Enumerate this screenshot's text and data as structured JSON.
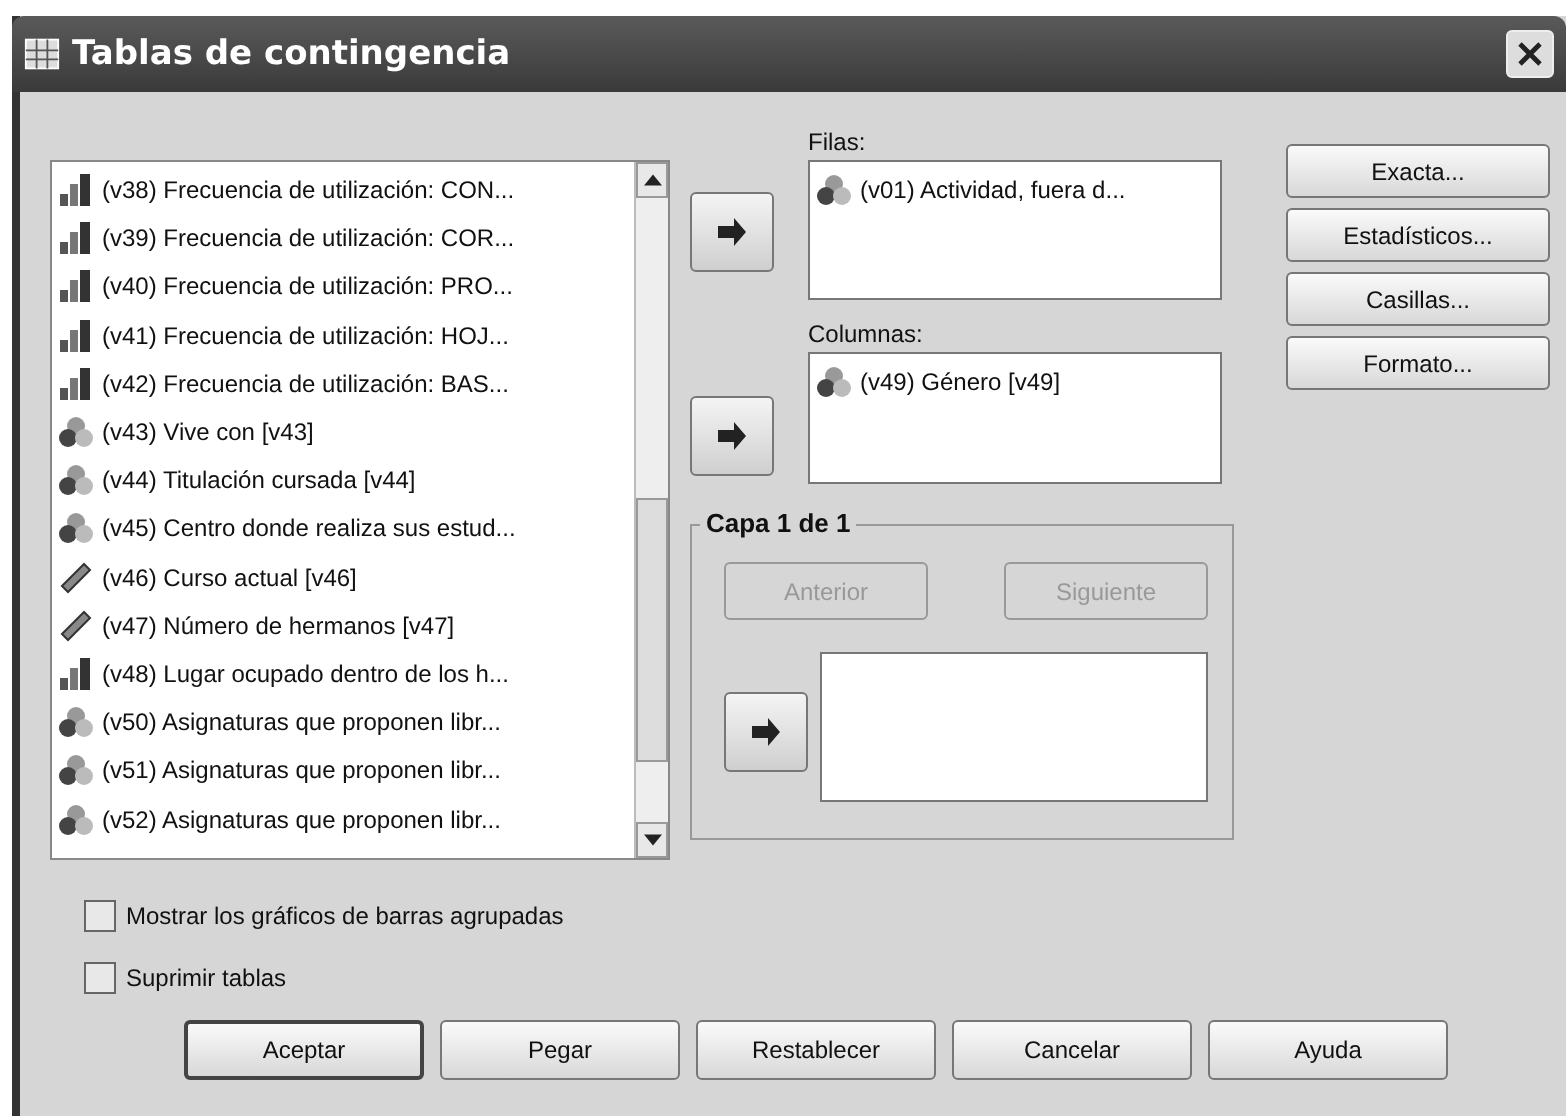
{
  "window": {
    "title": "Tablas de contingencia"
  },
  "variables": [
    {
      "kind": "ordinal",
      "label": "(v38) Frecuencia de utilización: CON...",
      "selected": false
    },
    {
      "kind": "ordinal",
      "label": "(v39) Frecuencia de utilización: COR...",
      "selected": false
    },
    {
      "kind": "ordinal",
      "label": "(v40) Frecuencia de utilización: PRO...",
      "selected": false
    },
    {
      "kind": "ordinal",
      "label": "(v41) Frecuencia de utilización: HOJ...",
      "selected": false
    },
    {
      "kind": "ordinal",
      "label": "(v42) Frecuencia de utilización: BAS...",
      "selected": false
    },
    {
      "kind": "nominal",
      "label": "(v43) Vive con [v43]",
      "selected": false
    },
    {
      "kind": "nominal",
      "label": "(v44) Titulación cursada [v44]",
      "selected": false
    },
    {
      "kind": "nominal",
      "label": "(v45) Centro donde realiza sus estud...",
      "selected": false
    },
    {
      "kind": "scale",
      "label": "(v46) Curso actual [v46]",
      "selected": false
    },
    {
      "kind": "scale",
      "label": "(v47) Número de hermanos [v47]",
      "selected": false
    },
    {
      "kind": "ordinal",
      "label": "(v48) Lugar ocupado dentro de los h...",
      "selected": false
    },
    {
      "kind": "nominal",
      "label": "(v50) Asignaturas que proponen libr...",
      "selected": false
    },
    {
      "kind": "nominal",
      "label": "(v51) Asignaturas que proponen libr...",
      "selected": false
    },
    {
      "kind": "nominal",
      "label": "(v52) Asignaturas que proponen libr...",
      "selected": false
    }
  ],
  "rows": {
    "label": "Filas:",
    "items": [
      {
        "kind": "nominal",
        "label": "(v01) Actividad, fuera d..."
      }
    ]
  },
  "columns": {
    "label": "Columnas:",
    "items": [
      {
        "kind": "nominal",
        "label": "(v49) Género [v49]"
      }
    ]
  },
  "layer": {
    "title": "Capa 1 de 1",
    "previous": {
      "label": "Anterior",
      "disabled": true
    },
    "next": {
      "label": "Siguiente",
      "disabled": true
    }
  },
  "side_buttons": [
    "Exacta...",
    "Estadísticos...",
    "Casillas...",
    "Formato..."
  ],
  "checkboxes": [
    {
      "label": "Mostrar los gráficos de barras agrupadas",
      "checked": false
    },
    {
      "label": "Suprimir tablas",
      "checked": false
    }
  ],
  "buttons": [
    {
      "label": "Aceptar",
      "default": true
    },
    {
      "label": "Pegar",
      "default": false
    },
    {
      "label": "Restablecer",
      "default": false
    },
    {
      "label": "Cancelar",
      "default": false
    },
    {
      "label": "Ayuda",
      "default": false
    }
  ]
}
